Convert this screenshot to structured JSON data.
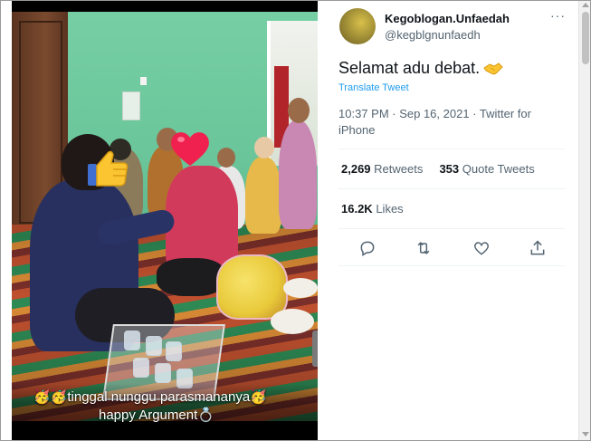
{
  "media": {
    "caption_line1": "🥳🥳tinggal nunggu parasmananya🥳",
    "caption_line2": "happy Argument💍",
    "prev_label": "‹"
  },
  "tweet": {
    "display_name": "Kegoblogan.Unfaedah",
    "handle": "@kegblgnunfaedh",
    "more": "···",
    "text": "Selamat adu debat.",
    "translate_label": "Translate Tweet",
    "meta": "10:37 PM · Sep 16, 2021 · Twitter for iPhone",
    "retweets_count": "2,269",
    "retweets_label": "Retweets",
    "quote_count": "353",
    "quote_label": "Quote Tweets",
    "likes_count": "16.2K",
    "likes_label": "Likes"
  },
  "icons": {
    "reply": "reply-icon",
    "retweet": "retweet-icon",
    "like": "like-icon",
    "share": "share-icon"
  },
  "colors": {
    "link": "#1d9bf0",
    "secondary_text": "#536471",
    "primary_text": "#0f1419"
  }
}
